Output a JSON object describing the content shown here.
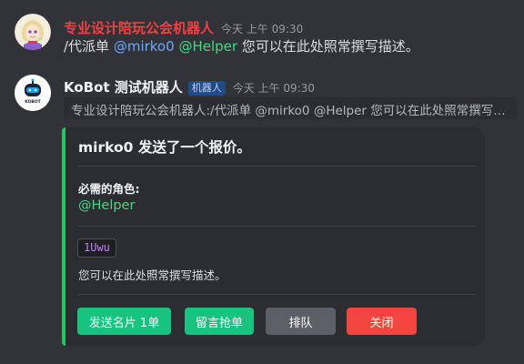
{
  "message1": {
    "username": "专业设计陪玩公会机器人",
    "username_color": "#f23f42",
    "timestamp": "今天 上午 09:30",
    "text_prefix": "/代派单 ",
    "mention1": "@mirko0",
    "mention2": "@Helper",
    "text_suffix": " 您可以在此处照常撰写描述。"
  },
  "message2": {
    "username": "KoBot 测试机器人",
    "badge": "机器人",
    "timestamp": "今天 上午 09:30",
    "reply_preview": "专业设计陪玩公会机器人:/代派单 @mirko0 @Helper 您可以在此处照常撰写描述...",
    "avatar_label": "KOBOT"
  },
  "embed": {
    "accent_color": "#22c55e",
    "title": "mirko0 发送了一个报价。",
    "field_name": "必需的角色:",
    "field_value": "@Helper",
    "code": "1Uwu",
    "description": "您可以在此处照常撰写描述。"
  },
  "buttons": {
    "send_card": "发送名片 1单",
    "grab_order": "留言抢单",
    "queue": "排队",
    "close": "关闭"
  }
}
